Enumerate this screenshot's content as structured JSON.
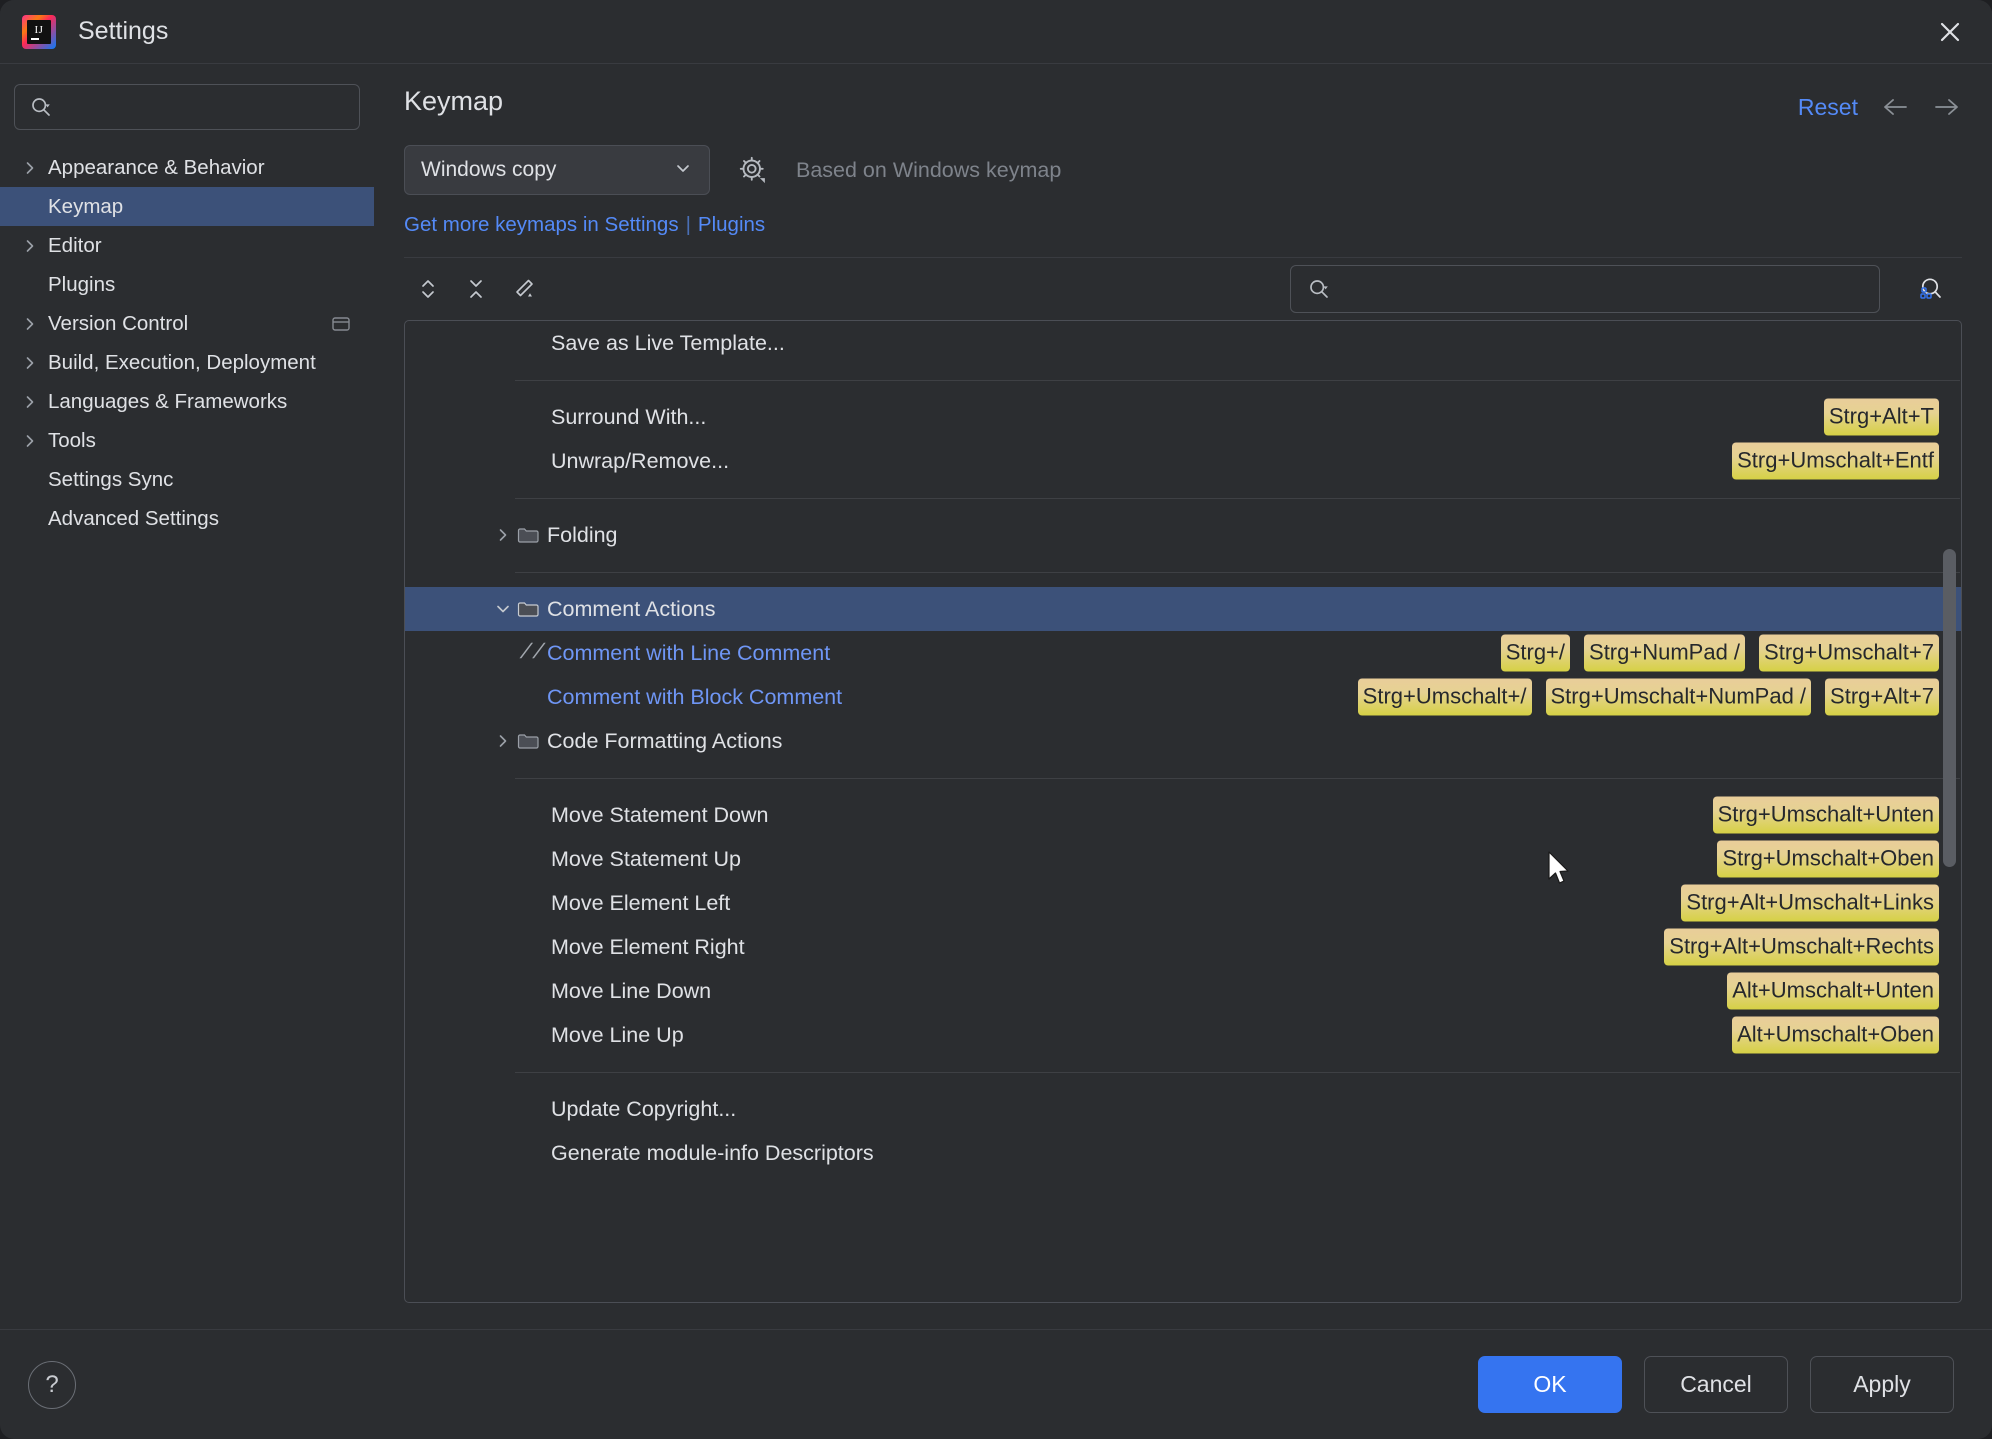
{
  "window": {
    "title": "Settings",
    "app_icon": "intellij-idea-icon",
    "close_icon": "close-icon"
  },
  "sidebar": {
    "search": {
      "placeholder": "",
      "value": "",
      "icon": "search-icon"
    },
    "items": [
      {
        "label": "Appearance & Behavior",
        "expandable": true,
        "selected": false
      },
      {
        "label": "Keymap",
        "expandable": false,
        "selected": true
      },
      {
        "label": "Editor",
        "expandable": true,
        "selected": false
      },
      {
        "label": "Plugins",
        "expandable": false,
        "selected": false
      },
      {
        "label": "Version Control",
        "expandable": true,
        "selected": false,
        "badge_icon": "project-scope-icon"
      },
      {
        "label": "Build, Execution, Deployment",
        "expandable": true,
        "selected": false
      },
      {
        "label": "Languages & Frameworks",
        "expandable": true,
        "selected": false
      },
      {
        "label": "Tools",
        "expandable": true,
        "selected": false
      },
      {
        "label": "Settings Sync",
        "expandable": false,
        "selected": false
      },
      {
        "label": "Advanced Settings",
        "expandable": false,
        "selected": false
      }
    ]
  },
  "main": {
    "page_title": "Keymap",
    "reset_label": "Reset",
    "back_icon": "arrow-left-icon",
    "forward_icon": "arrow-right-icon",
    "keymap_select": {
      "value": "Windows copy",
      "chevron_icon": "chevron-down-icon"
    },
    "gear_icon": "gear-icon",
    "based_on": "Based on Windows keymap",
    "links": {
      "get_more": "Get more keymaps in Settings",
      "separator": "|",
      "plugins": "Plugins"
    },
    "toolbar": {
      "expand_all_icon": "expand-all-icon",
      "collapse_all_icon": "collapse-all-icon",
      "edit_shortcut_icon": "edit-pencil-icon",
      "search": {
        "placeholder": "",
        "value": "",
        "icon": "search-icon"
      },
      "find_by_shortcut_icon": "find-by-shortcut-icon"
    }
  },
  "tree": {
    "rows": [
      {
        "type": "action",
        "label": "Save as Live Template...",
        "indent": 1,
        "shortcuts": []
      },
      {
        "type": "separator"
      },
      {
        "type": "action",
        "label": "Surround With...",
        "indent": 1,
        "shortcuts": [
          "Strg+Alt+T"
        ]
      },
      {
        "type": "action",
        "label": "Unwrap/Remove...",
        "indent": 1,
        "shortcuts": [
          "Strg+Umschalt+Entf"
        ]
      },
      {
        "type": "separator"
      },
      {
        "type": "group",
        "label": "Folding",
        "indent": 0,
        "expanded": false,
        "icon": "folder-icon",
        "shortcuts": []
      },
      {
        "type": "separator"
      },
      {
        "type": "group",
        "label": "Comment Actions",
        "indent": 0,
        "expanded": true,
        "selected": true,
        "icon": "folder-icon",
        "shortcuts": []
      },
      {
        "type": "action",
        "label": "Comment with Line Comment",
        "indent": 1,
        "link": true,
        "icon": "line-comment-icon",
        "shortcuts": [
          "Strg+/",
          "Strg+NumPad /",
          "Strg+Umschalt+7"
        ]
      },
      {
        "type": "action",
        "label": "Comment with Block Comment",
        "indent": 1,
        "link": true,
        "shortcuts": [
          "Strg+Umschalt+/",
          "Strg+Umschalt+NumPad /",
          "Strg+Alt+7"
        ]
      },
      {
        "type": "group",
        "label": "Code Formatting Actions",
        "indent": 0,
        "expanded": false,
        "icon": "folder-icon",
        "shortcuts": []
      },
      {
        "type": "separator"
      },
      {
        "type": "action",
        "label": "Move Statement Down",
        "indent": 1,
        "shortcuts": [
          "Strg+Umschalt+Unten"
        ]
      },
      {
        "type": "action",
        "label": "Move Statement Up",
        "indent": 1,
        "shortcuts": [
          "Strg+Umschalt+Oben"
        ]
      },
      {
        "type": "action",
        "label": "Move Element Left",
        "indent": 1,
        "shortcuts": [
          "Strg+Alt+Umschalt+Links"
        ]
      },
      {
        "type": "action",
        "label": "Move Element Right",
        "indent": 1,
        "shortcuts": [
          "Strg+Alt+Umschalt+Rechts"
        ]
      },
      {
        "type": "action",
        "label": "Move Line Down",
        "indent": 1,
        "shortcuts": [
          "Alt+Umschalt+Unten"
        ]
      },
      {
        "type": "action",
        "label": "Move Line Up",
        "indent": 1,
        "shortcuts": [
          "Alt+Umschalt+Oben"
        ]
      },
      {
        "type": "separator"
      },
      {
        "type": "action",
        "label": "Update Copyright...",
        "indent": 1,
        "shortcuts": []
      },
      {
        "type": "action",
        "label": "Generate module-info Descriptors",
        "indent": 1,
        "shortcuts": []
      }
    ]
  },
  "footer": {
    "help_label": "?",
    "ok_label": "OK",
    "cancel_label": "Cancel",
    "apply_label": "Apply"
  },
  "colors": {
    "accent_blue": "#3574f0",
    "link_blue": "#548af7",
    "selection_blue": "#3c5179",
    "shortcut_badge_top": "#e9cd9a",
    "shortcut_badge_bottom": "#d6d145",
    "window_bg": "#2b2d30"
  }
}
